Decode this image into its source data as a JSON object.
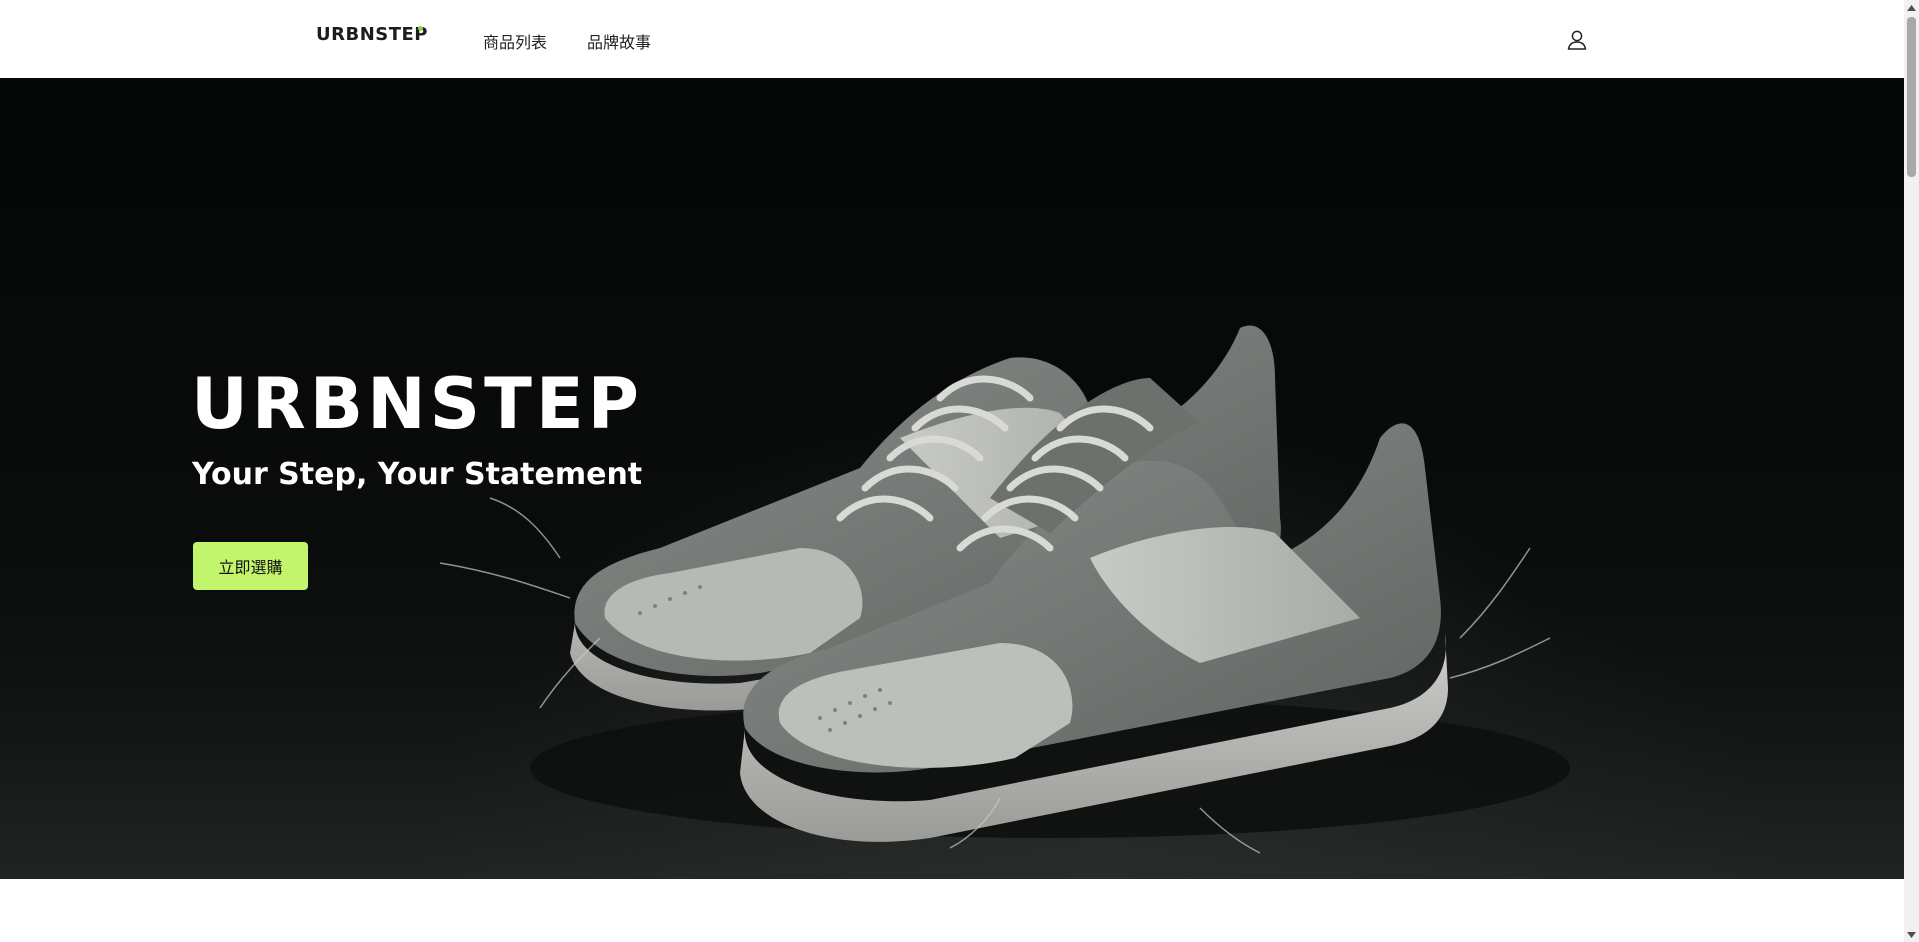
{
  "header": {
    "logo": "URBNSTEP",
    "nav": [
      {
        "label": "商品列表"
      },
      {
        "label": "品牌故事"
      }
    ],
    "user_icon": "user-icon"
  },
  "hero": {
    "title": "URBNSTEP",
    "subtitle": "Your Step, Your Statement",
    "cta_label": "立即選購",
    "image": "sneaker-photo"
  },
  "colors": {
    "accent": "#c2f56b",
    "logo_dot": "#8fd14f",
    "hero_bg": "#0a0c0b",
    "text_dark": "#1c1c1c"
  }
}
